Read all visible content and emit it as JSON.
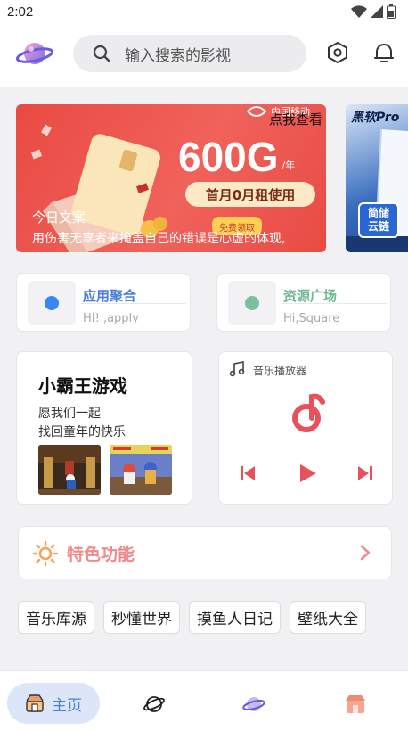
{
  "status": {
    "time": "2:02"
  },
  "search": {
    "placeholder": "输入搜索的影视"
  },
  "banner": {
    "carrier": "中国移动",
    "view_label": "点我查看",
    "big_text": "600G",
    "unit": "/年",
    "sub_text": "首月0月租使用",
    "badge": "免费领取",
    "quote_title": "今日文案",
    "quote_text": "用伤害无辜者来掩盖自己的错误是心虚的体现,",
    "side_title": "黑软Pro",
    "side_badge": "简储云链"
  },
  "cards": [
    {
      "title": "应用聚合",
      "subtitle": "HI! ,apply",
      "dot_color": "#3a86f5"
    },
    {
      "title": "资源广场",
      "subtitle": "Hi,Square",
      "dot_color": "#7bbf9e"
    }
  ],
  "game": {
    "title": "小霸王游戏",
    "line1": "愿我们一起",
    "line2": "找回童年的快乐"
  },
  "music": {
    "label": "音乐播放器"
  },
  "feature": {
    "label": "特色功能"
  },
  "tags": [
    "音乐库源",
    "秒懂世界",
    "摸鱼人日记",
    "壁纸大全"
  ],
  "nav": {
    "home_label": "主页"
  },
  "colors": {
    "accent_blue": "#4a7fd8",
    "accent_red": "#f0625b",
    "music_red": "#e8505b",
    "feature_pink": "#f08b8b",
    "feature_orange": "#f7a35c"
  }
}
